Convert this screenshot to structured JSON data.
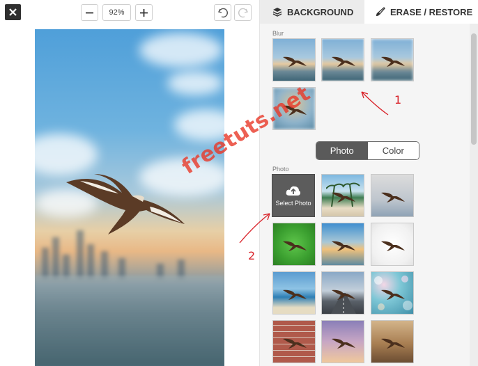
{
  "toolbar": {
    "zoom_value": "92%"
  },
  "tabs": {
    "background_label": "BACKGROUND",
    "erase_label": "ERASE / RESTORE"
  },
  "panel": {
    "blur_label": "Blur",
    "photo_section_label": "Photo",
    "toggle": {
      "photo_label": "Photo",
      "color_label": "Color",
      "selected": "Photo"
    },
    "select_photo_label": "Select Photo"
  },
  "annotations": {
    "arrow1_number": "1",
    "arrow2_number": "2",
    "watermark_text": "freetuts.net"
  },
  "colors": {
    "annotation_red": "#d9232a",
    "toggle_active": "#5a5a5a",
    "close_button": "#2f2f2f"
  },
  "icons": [
    "close-icon",
    "minus-icon",
    "plus-icon",
    "undo-icon",
    "redo-icon",
    "layers-icon",
    "brush-icon",
    "cloud-upload-icon"
  ]
}
